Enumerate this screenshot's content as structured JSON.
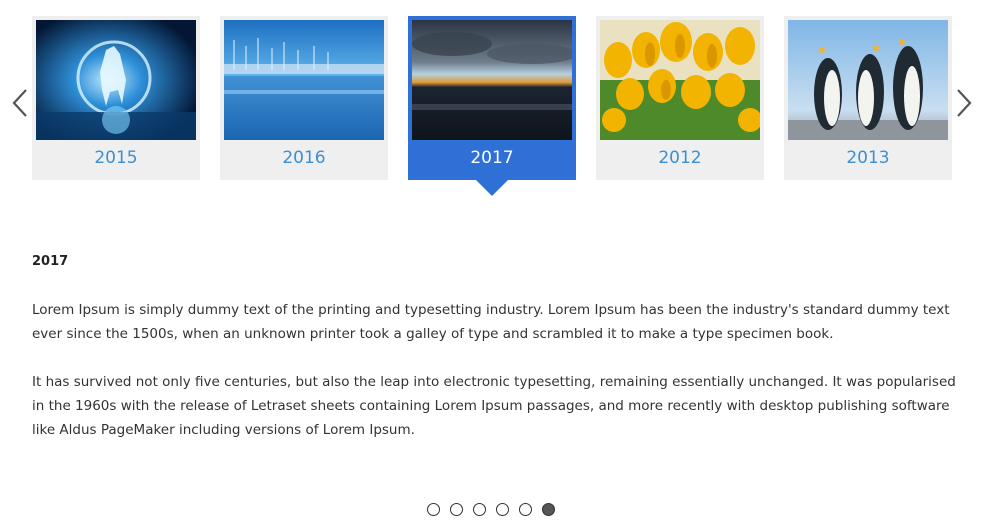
{
  "carousel": {
    "prev_icon": "chevron-left-icon",
    "next_icon": "chevron-right-icon",
    "items": [
      {
        "year": "2015",
        "image": "unicorn-moon-night-image",
        "active": false
      },
      {
        "year": "2016",
        "image": "harbor-sailboats-image",
        "active": false
      },
      {
        "year": "2017",
        "image": "sunset-sea-clouds-image",
        "active": true
      },
      {
        "year": "2012",
        "image": "yellow-tulips-image",
        "active": false
      },
      {
        "year": "2013",
        "image": "penguins-image",
        "active": false
      }
    ]
  },
  "detail": {
    "title": "2017",
    "paragraphs": [
      "Lorem Ipsum is simply dummy text of the printing and typesetting industry. Lorem Ipsum has been the industry's standard dummy text ever since the 1500s, when an unknown printer took a galley of type and scrambled it to make a type specimen book.",
      "It has survived not only five centuries, but also the leap into electronic typesetting, remaining essentially unchanged. It was popularised in the 1960s with the release of Letraset sheets containing Lorem Ipsum passages, and more recently with desktop publishing software like Aldus PageMaker including versions of Lorem Ipsum."
    ]
  },
  "pagination": {
    "pages": 6,
    "current": 6
  },
  "colors": {
    "accent": "#2f70d7",
    "year_link": "#3b8fd6",
    "card_bg": "#efefef"
  }
}
